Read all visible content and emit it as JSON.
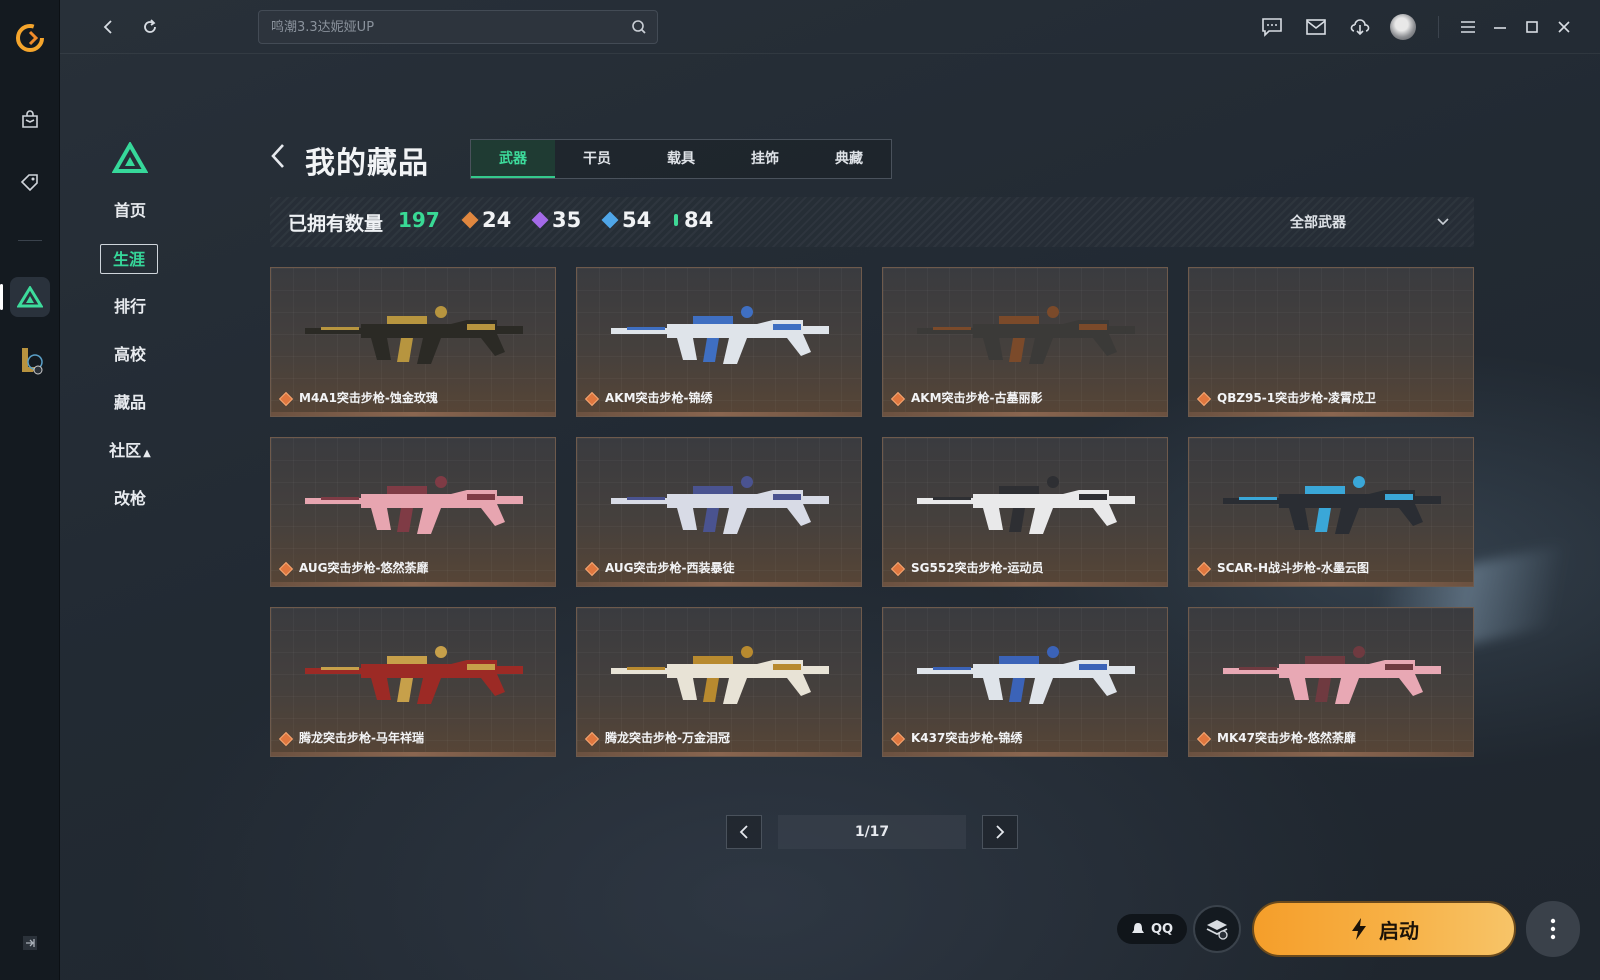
{
  "search": {
    "placeholder": "鸣潮3.3达妮娅UP"
  },
  "subnav": {
    "items": [
      {
        "label": "首页"
      },
      {
        "label": "生涯"
      },
      {
        "label": "排行"
      },
      {
        "label": "高校"
      },
      {
        "label": "藏品"
      },
      {
        "label": "社区"
      },
      {
        "label": "改枪"
      }
    ],
    "active": "生涯"
  },
  "header": {
    "title": "我的藏品",
    "tabs": [
      "武器",
      "干员",
      "载具",
      "挂饰",
      "典藏"
    ],
    "active_tab": "武器"
  },
  "stats": {
    "owned_label": "已拥有数量",
    "owned_count": "197",
    "rarities": [
      {
        "value": "24",
        "color": "#e0873f"
      },
      {
        "value": "35",
        "color": "#a46ae8"
      },
      {
        "value": "54",
        "color": "#4fa6e8"
      },
      {
        "value": "84",
        "color": "#3fd896"
      }
    ],
    "filter_label": "全部武器"
  },
  "items": [
    {
      "name": "M4A1突击步枪-蚀金玫瑰",
      "palette": [
        "#2b2a25",
        "#b7953f"
      ]
    },
    {
      "name": "AKM突击步枪-锦绣",
      "palette": [
        "#dfe4ea",
        "#3f6fc2"
      ]
    },
    {
      "name": "AKM突击步枪-古墓丽影",
      "palette": [
        "#3b3a38",
        "#7b4a2a"
      ]
    },
    {
      "name": "QBZ95-1突击步枪-凌霄戍卫",
      "palette": []
    },
    {
      "name": "AUG突击步枪-悠然荼靡",
      "palette": [
        "#e7a5b0",
        "#7f3b45"
      ]
    },
    {
      "name": "AUG突击步枪-西装暴徒",
      "palette": [
        "#d8dbe6",
        "#4a5390"
      ]
    },
    {
      "name": "SG552突击步枪-运动员",
      "palette": [
        "#e9e9ea",
        "#2e2f33"
      ]
    },
    {
      "name": "SCAR-H战斗步枪-水墨云图",
      "palette": [
        "#2a2d33",
        "#3aa7d8"
      ]
    },
    {
      "name": "腾龙突击步枪-马年祥瑞",
      "palette": [
        "#9c2a25",
        "#c7a04a"
      ]
    },
    {
      "name": "腾龙突击步枪-万金泪冠",
      "palette": [
        "#e8e3d6",
        "#b88a2f"
      ]
    },
    {
      "name": "K437突击步枪-锦绣",
      "palette": [
        "#dfe4ea",
        "#3b63b8"
      ]
    },
    {
      "name": "MK47突击步枪-悠然荼靡",
      "palette": [
        "#e8a8b4",
        "#6f3a40"
      ]
    }
  ],
  "pagination": {
    "page_label": "1/17"
  },
  "bottom": {
    "qq_label": "QQ",
    "launch_label": "启动"
  },
  "colors": {
    "accent_green": "#36d89a",
    "launch_orange": "#f7a83a",
    "card_border": "#6e5a4c"
  },
  "icons": {
    "rail": [
      "app-logo-icon",
      "store-bag-icon",
      "tag-icon",
      "delta-force-icon",
      "league-icon",
      "collapse-icon"
    ],
    "topbar": [
      "back-icon",
      "refresh-icon",
      "search-icon",
      "chat-icon",
      "mail-icon",
      "download-icon",
      "avatar",
      "menu-icon",
      "minimize-icon",
      "maximize-icon",
      "close-icon"
    ]
  }
}
